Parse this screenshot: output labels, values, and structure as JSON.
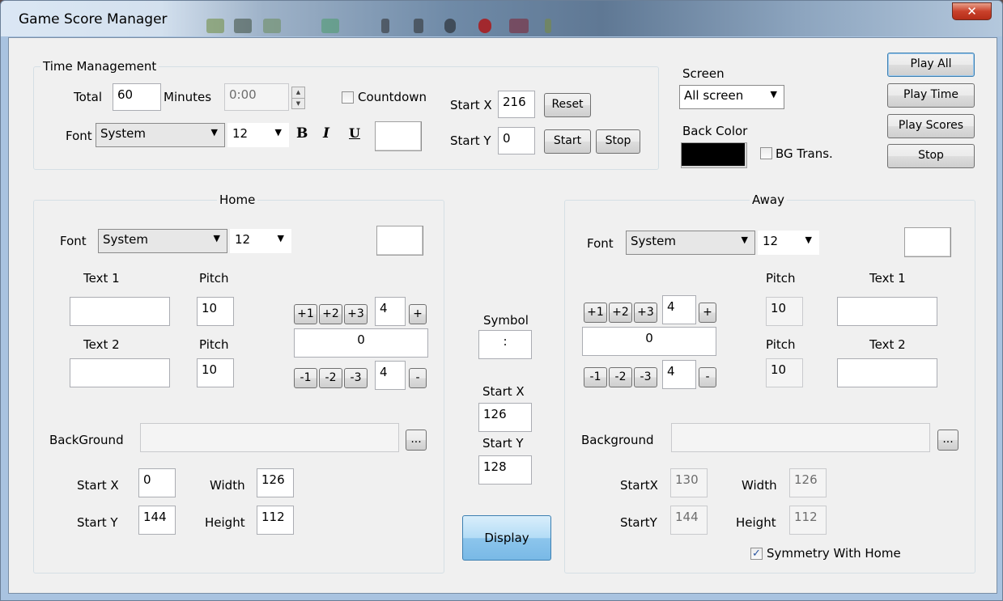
{
  "window": {
    "title": "Game Score Manager",
    "close_glyph": "✕"
  },
  "time_group": {
    "title": "Time Management",
    "total_label": "Total",
    "total_value": "60",
    "minutes_label": "Minutes",
    "time_value": "0:00",
    "countdown_label": "Countdown",
    "countdown_checked": false,
    "font_label": "Font",
    "font_value": "System",
    "size_value": "12",
    "bold": "B",
    "italic": "I",
    "underline": "U",
    "start_x_label": "Start X",
    "start_x_value": "216",
    "start_y_label": "Start Y",
    "start_y_value": "0",
    "reset_label": "Reset",
    "start_label": "Start",
    "stop_label": "Stop"
  },
  "screen": {
    "label": "Screen",
    "value": "All screen",
    "back_color_label": "Back Color",
    "back_color": "#000000",
    "bg_trans_label": "BG Trans.",
    "bg_trans_checked": false
  },
  "play": {
    "play_all": "Play All",
    "play_time": "Play Time",
    "play_scores": "Play Scores",
    "stop": "Stop"
  },
  "home": {
    "title": "Home",
    "font_label": "Font",
    "font_value": "System",
    "size_value": "12",
    "text1_label": "Text 1",
    "text1_value": "",
    "pitch1_label": "Pitch",
    "pitch1_value": "10",
    "text2_label": "Text 2",
    "text2_value": "",
    "pitch2_label": "Pitch",
    "pitch2_value": "10",
    "plus_buttons": [
      "+1",
      "+2",
      "+3"
    ],
    "plus_step": "4",
    "plus_label": "+",
    "score": "0",
    "minus_buttons": [
      "-1",
      "-2",
      "-3"
    ],
    "minus_step": "4",
    "minus_label": "-",
    "background_label": "BackGround",
    "background_value": "",
    "browse_label": "...",
    "start_x_label": "Start X",
    "start_x_value": "0",
    "start_y_label": "Start Y",
    "start_y_value": "144",
    "width_label": "Width",
    "width_value": "126",
    "height_label": "Height",
    "height_value": "112"
  },
  "center": {
    "symbol_label": "Symbol",
    "symbol_value": ":",
    "start_x_label": "Start X",
    "start_x_value": "126",
    "start_y_label": "Start Y",
    "start_y_value": "128",
    "display_label": "Display"
  },
  "away": {
    "title": "Away",
    "font_label": "Font",
    "font_value": "System",
    "size_value": "12",
    "pitch1_label": "Pitch",
    "pitch1_value": "10",
    "text1_label": "Text 1",
    "text1_value": "",
    "pitch2_label": "Pitch",
    "pitch2_value": "10",
    "text2_label": "Text 2",
    "text2_value": "",
    "plus_buttons": [
      "+1",
      "+2",
      "+3"
    ],
    "plus_step": "4",
    "plus_label": "+",
    "score": "0",
    "minus_buttons": [
      "-1",
      "-2",
      "-3"
    ],
    "minus_step": "4",
    "minus_label": "-",
    "background_label": "Background",
    "background_value": "",
    "browse_label": "...",
    "start_x_label": "StartX",
    "start_x_value": "130",
    "start_y_label": "StartY",
    "start_y_value": "144",
    "width_label": "Width",
    "width_value": "126",
    "height_label": "Height",
    "height_value": "112",
    "symmetry_label": "Symmetry With Home",
    "symmetry_checked": true
  }
}
